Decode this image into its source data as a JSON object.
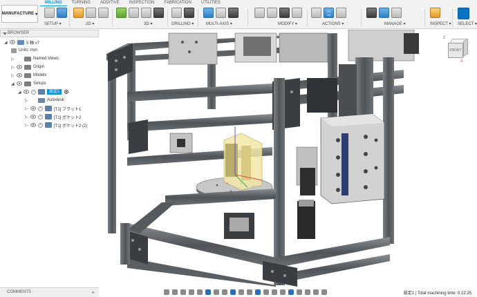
{
  "workspace": {
    "label": "MANUFACTURE"
  },
  "tabs": [
    "MILLING",
    "TURNING",
    "ADDITIVE",
    "INSPECTION",
    "FABRICATION",
    "UTILITIES"
  ],
  "active_tab": "MILLING",
  "groups": [
    {
      "label": "SETUP ▾"
    },
    {
      "label": "2D ▾"
    },
    {
      "label": "3D ▾"
    },
    {
      "label": "DRILLING ▾"
    },
    {
      "label": "MULTI-AXIS ▾"
    },
    {
      "label": "MODIFY ▾"
    },
    {
      "label": "ACTIONS ▾"
    },
    {
      "label": "MANAGE ▾"
    },
    {
      "label": "INSPECT ▾"
    },
    {
      "label": "SELECT ▾"
    }
  ],
  "actions_badge": {
    "top": "G1",
    "bottom": "G2"
  },
  "browser": {
    "title": "BROWSER",
    "items": [
      {
        "label": "5 軸 v7"
      },
      {
        "label": "Units: mm"
      },
      {
        "label": "Named Views"
      },
      {
        "label": "Origin"
      },
      {
        "label": "Models"
      },
      {
        "label": "Setups"
      },
      {
        "label": "設定1"
      },
      {
        "label": "Autodesk"
      },
      {
        "label": "[T1] フラット1"
      },
      {
        "label": "[T1] ポケット2"
      },
      {
        "label": "[T1] ポケット2 (2)"
      }
    ]
  },
  "viewcube": {
    "front": "FRONT",
    "z": "Z",
    "x": "X"
  },
  "comments": {
    "label": "COMMENTS"
  },
  "status": {
    "text": "設定1 | Total machining time: 0:22:25"
  },
  "colors": {
    "accent": "#0696d7",
    "frame": "#555a5f",
    "part": "#e8d89a",
    "tool_path": "#d84d4d"
  }
}
